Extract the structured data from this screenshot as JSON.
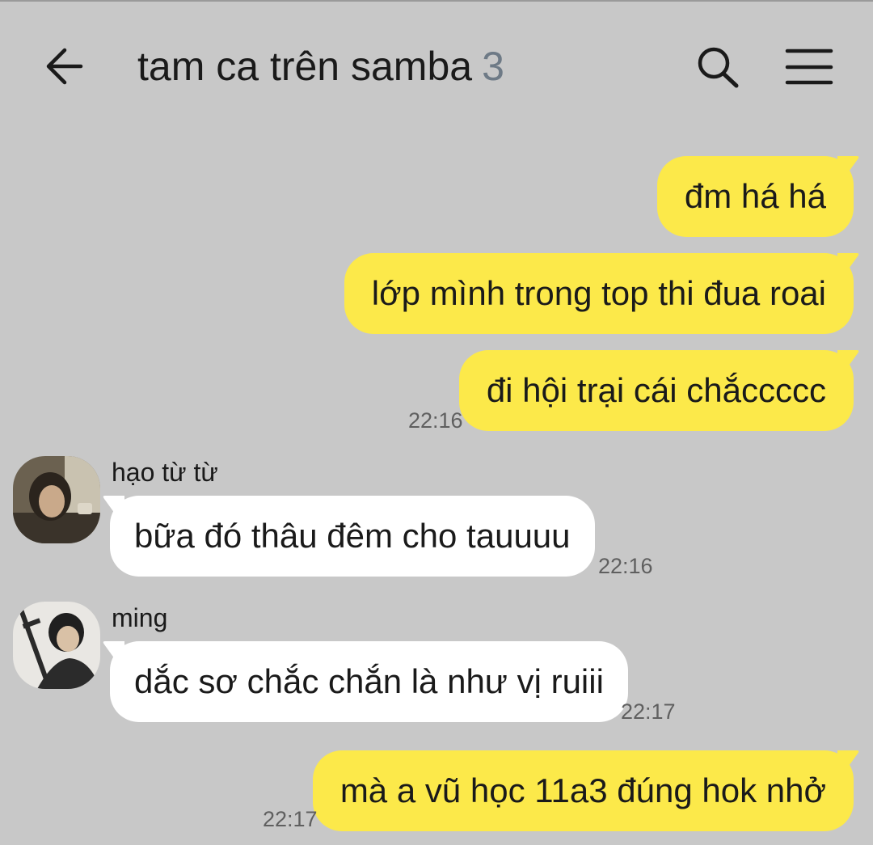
{
  "header": {
    "title": "tam ca trên samba",
    "member_count": "3",
    "back_icon": "arrow-left-icon",
    "search_icon": "search-icon",
    "menu_icon": "hamburger-menu-icon"
  },
  "colors": {
    "background": "#c8c8c8",
    "outgoing_bubble": "#fce94a",
    "incoming_bubble": "#ffffff",
    "timestamp": "#5f5f5f",
    "member_count": "#6e7a86"
  },
  "messages": [
    {
      "direction": "out",
      "text": "đm há há"
    },
    {
      "direction": "out",
      "text": "lớp mình trong top thi đua roai"
    },
    {
      "direction": "out",
      "text": "đi hội trại cái chắccccc",
      "time": "22:16"
    },
    {
      "direction": "in",
      "sender": "hạo từ từ",
      "text": "bữa đó thâu đêm cho tauuuu",
      "time": "22:16"
    },
    {
      "direction": "in",
      "sender": "ming",
      "text": "dắc sơ chắc chắn là như vị ruiii",
      "time": "22:17"
    },
    {
      "direction": "out",
      "text": "mà a vũ học 11a3 đúng hok nhở",
      "time": "22:17"
    }
  ]
}
